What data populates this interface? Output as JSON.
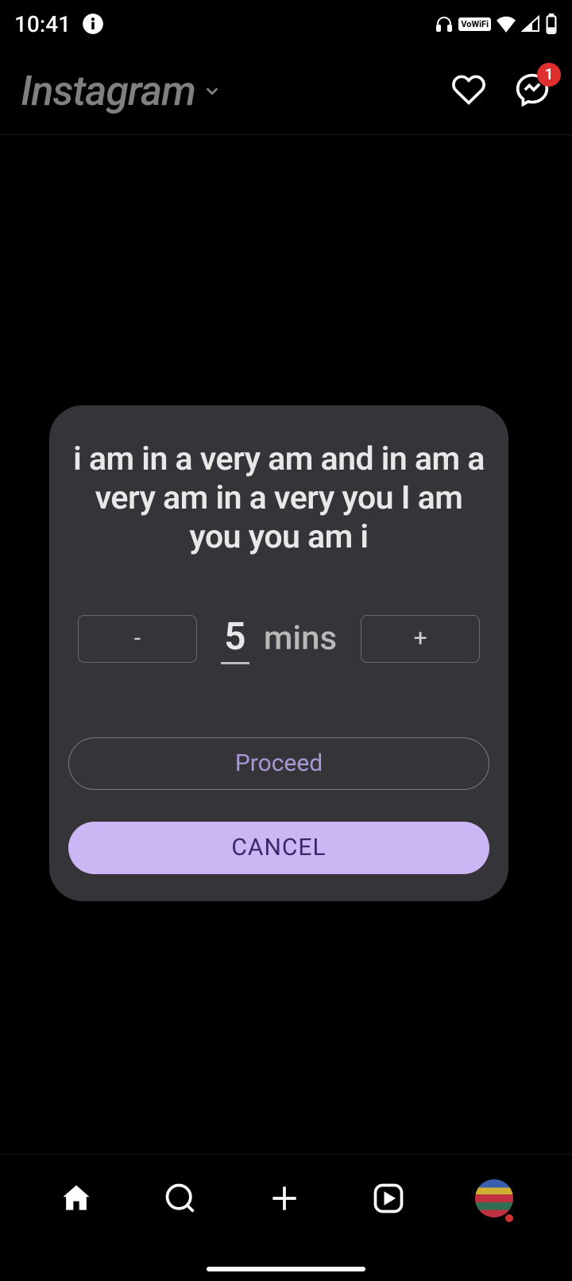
{
  "status": {
    "time": "10:41",
    "vowifi": "VoWiFi"
  },
  "header": {
    "logo": "Instagram",
    "badge_count": "1"
  },
  "dialog": {
    "title": "i am in a very am and in am a very am in a very you I am you you am i",
    "minus": "-",
    "value": "5",
    "unit": "mins",
    "plus": "+",
    "proceed": "Proceed",
    "cancel": "CANCEL"
  }
}
